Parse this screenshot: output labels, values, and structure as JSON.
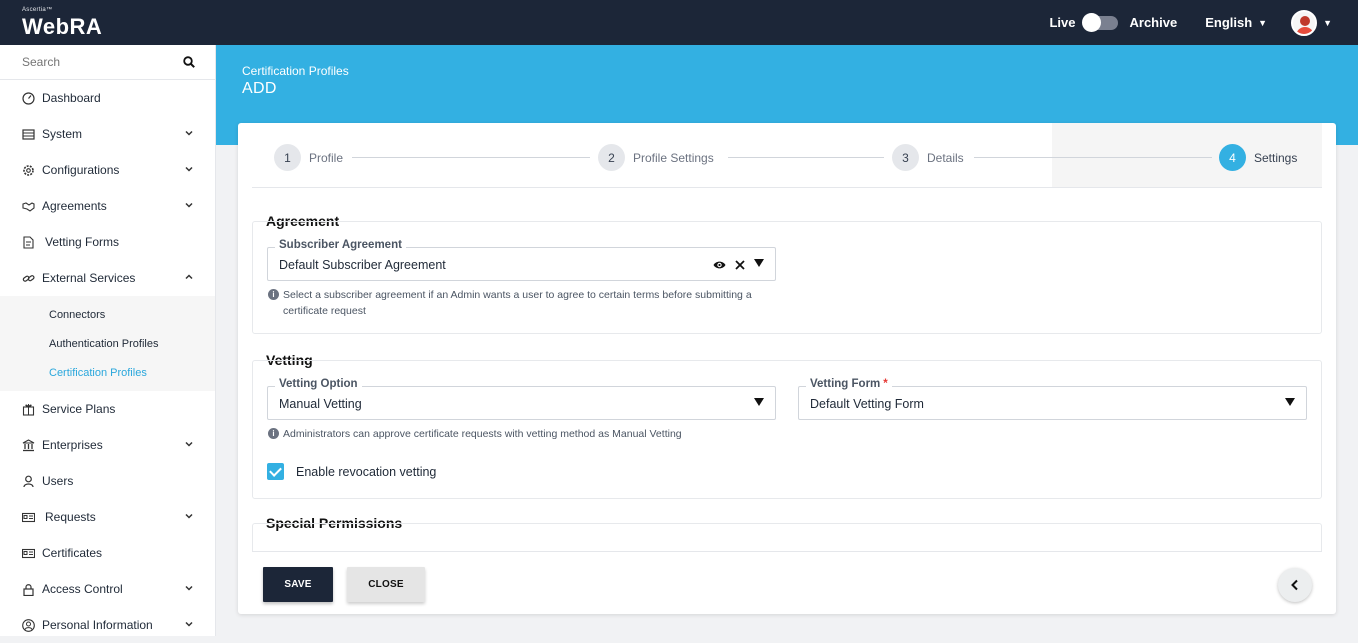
{
  "topbar": {
    "logo_small": "Ascertia™",
    "logo_big": "WebRA",
    "live_label": "Live",
    "archive_label": "Archive",
    "language": "English"
  },
  "sidebar": {
    "search_placeholder": "Search",
    "items": [
      {
        "label": "Dashboard",
        "icon": "dashboard-icon"
      },
      {
        "label": "System",
        "icon": "system-icon"
      },
      {
        "label": "Configurations",
        "icon": "gear-icon"
      },
      {
        "label": "Agreements",
        "icon": "handshake-icon"
      },
      {
        "label": "Vetting Forms",
        "icon": "form-icon"
      },
      {
        "label": "External Services",
        "icon": "link-icon"
      },
      {
        "label": "Service Plans",
        "icon": "gift-icon"
      },
      {
        "label": "Enterprises",
        "icon": "bank-icon"
      },
      {
        "label": "Users",
        "icon": "user-icon"
      },
      {
        "label": "Requests",
        "icon": "requests-icon"
      },
      {
        "label": "Certificates",
        "icon": "certificate-icon"
      },
      {
        "label": "Access Control",
        "icon": "lock-icon"
      },
      {
        "label": "Personal Information",
        "icon": "person-icon"
      }
    ],
    "sub_items": [
      {
        "label": "Connectors"
      },
      {
        "label": "Authentication Profiles"
      },
      {
        "label": "Certification Profiles"
      }
    ]
  },
  "header": {
    "breadcrumb": "Certification Profiles",
    "title": "ADD"
  },
  "steps": [
    {
      "num": "1",
      "label": "Profile"
    },
    {
      "num": "2",
      "label": "Profile Settings"
    },
    {
      "num": "3",
      "label": "Details"
    },
    {
      "num": "4",
      "label": "Settings"
    }
  ],
  "agreement": {
    "title": "Agreement",
    "field_label": "Subscriber Agreement",
    "field_value": "Default Subscriber Agreement",
    "helper": "Select a subscriber agreement if an Admin wants a user to agree to certain terms before submitting a certificate request"
  },
  "vetting": {
    "title": "Vetting",
    "option_label": "Vetting Option",
    "option_value": "Manual Vetting",
    "form_label": "Vetting Form",
    "form_required": "*",
    "form_value": "Default Vetting Form",
    "helper": "Administrators can approve certificate requests with vetting method as Manual Vetting",
    "revocation_label": "Enable revocation vetting"
  },
  "special": {
    "title": "Special Permissions"
  },
  "footer": {
    "save_label": "SAVE",
    "close_label": "CLOSE"
  },
  "colors": {
    "topbar": "#1c2638",
    "accent": "#33b0e2",
    "active_link": "#2aa7dc"
  }
}
